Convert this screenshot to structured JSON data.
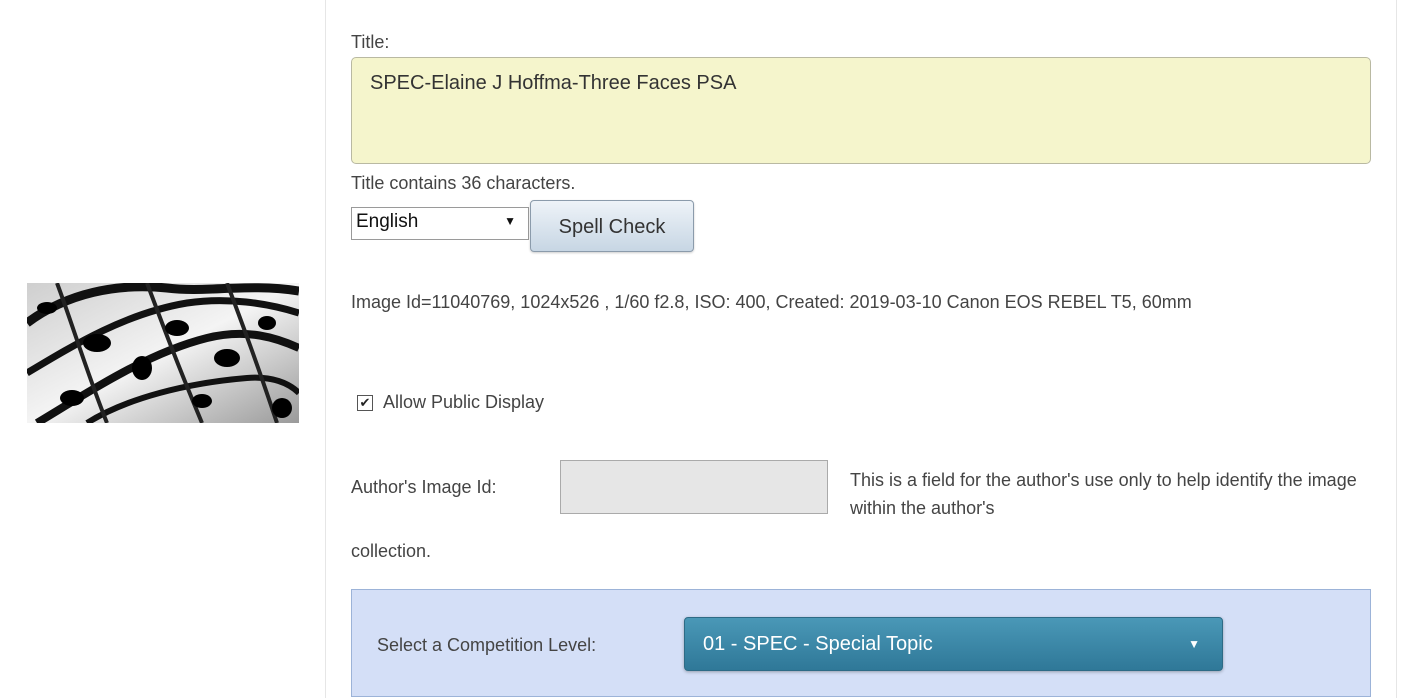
{
  "thumbnail": {
    "icon": "butterfly-wing-thumbnail"
  },
  "title_field": {
    "label": "Title:",
    "value": "SPEC-Elaine J Hoffma-Three Faces PSA",
    "count_text": "Title contains 36 characters."
  },
  "spell": {
    "language": "English",
    "button_label": "Spell Check"
  },
  "image_info": "Image Id=11040769, 1024x526 , 1/60 f2.8, ISO: 400, Created: 2019-03-10 Canon EOS REBEL T5, 60mm",
  "allow_public": {
    "label": "Allow Public Display",
    "checked": true
  },
  "author_id": {
    "label": "Author's Image Id:",
    "value": "",
    "help_text": "This is a field for the author's use only to help identify the image within the author's",
    "help_text_cont": "collection."
  },
  "competition": {
    "label": "Select a Competition Level:",
    "selected": "01 - SPEC - Special Topic"
  },
  "colors": {
    "title_bg": "#f5f5cc",
    "panel_bg": "#d4dff7",
    "select_bg": "#3a86a7"
  }
}
